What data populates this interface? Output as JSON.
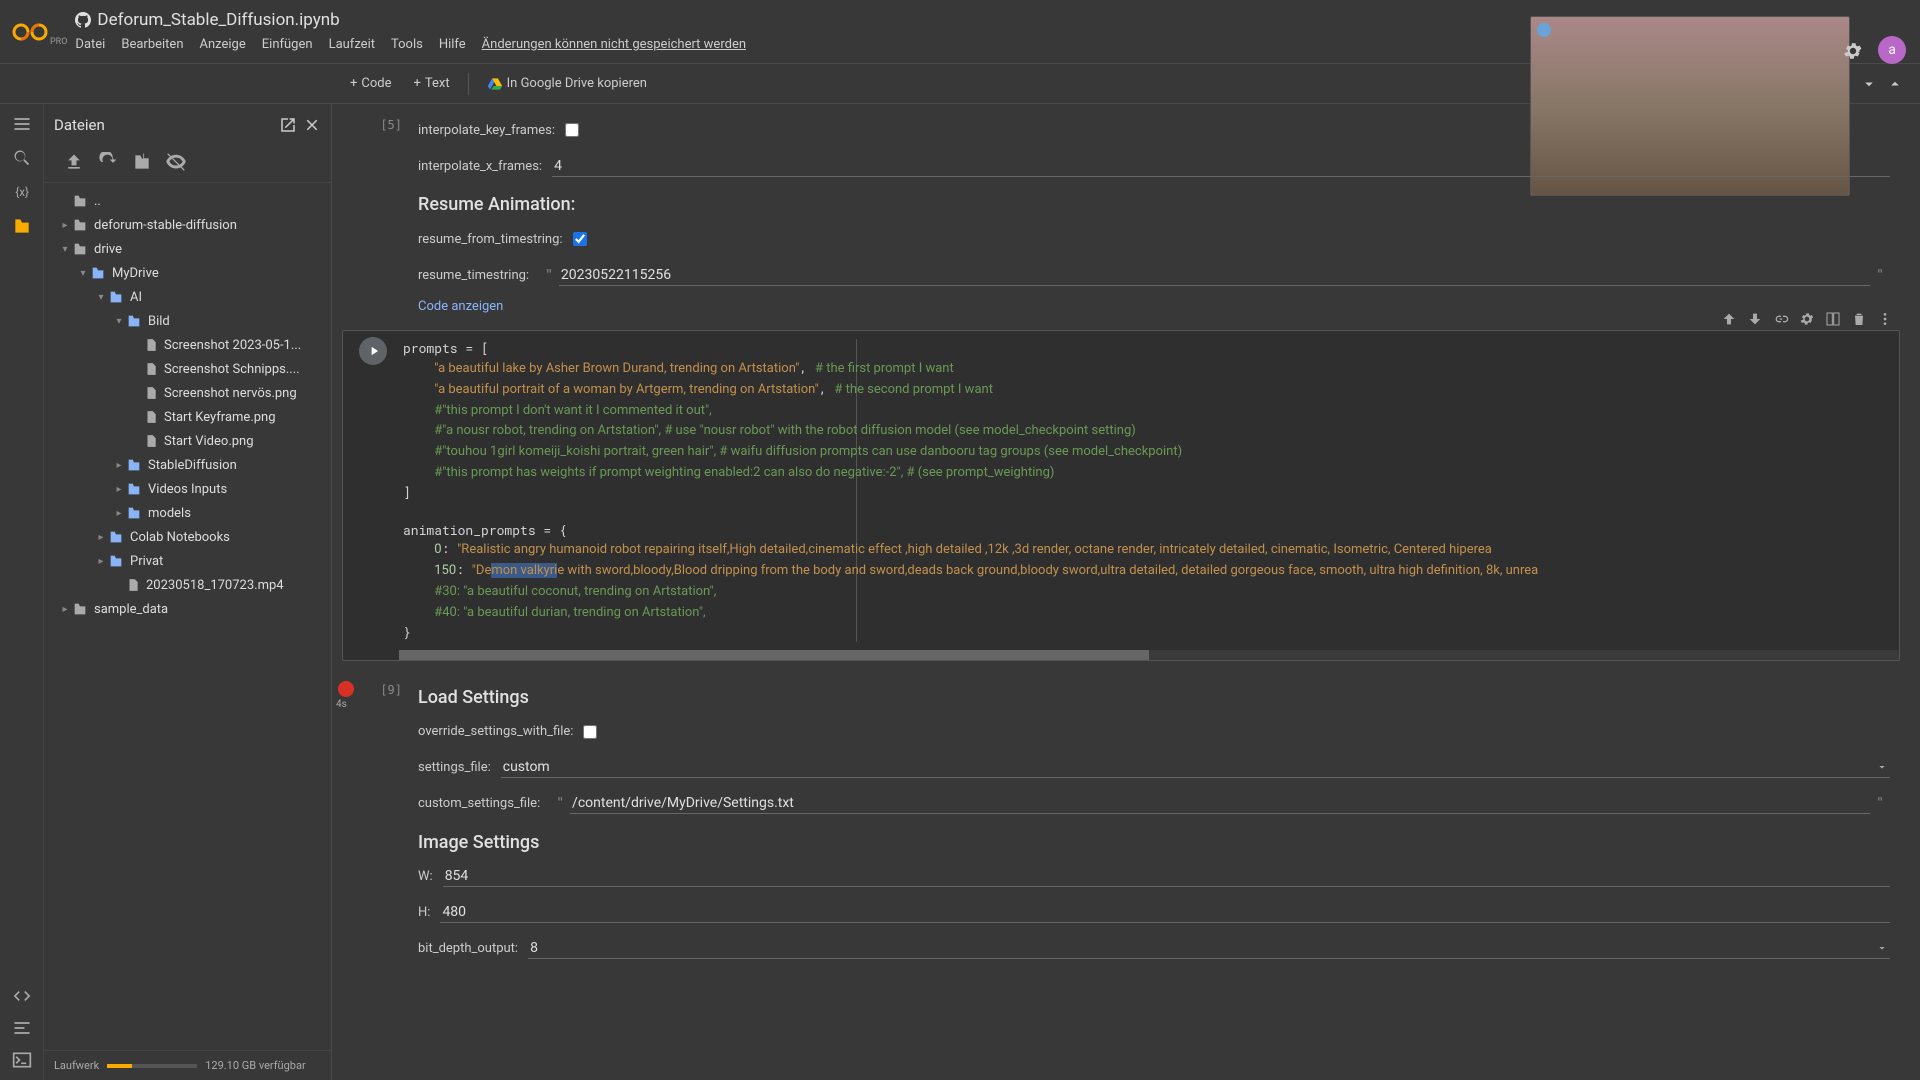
{
  "header": {
    "pro_label": "PRO",
    "notebook_title": "Deforum_Stable_Diffusion.ipynb",
    "menus": [
      "Datei",
      "Bearbeiten",
      "Anzeige",
      "Einfügen",
      "Laufzeit",
      "Tools",
      "Hilfe"
    ],
    "save_warning": "Änderungen können nicht gespeichert werden",
    "avatar_letter": "a"
  },
  "toolbar": {
    "code_label": "Code",
    "text_label": "Text",
    "drive_label": "In Google Drive kopieren"
  },
  "sidebar": {
    "title": "Dateien",
    "disk_label": "Laufwerk",
    "disk_free": "129.10 GB verfügbar",
    "tree": {
      "up_label": "..",
      "deforum": "deforum-stable-diffusion",
      "drive": "drive",
      "mydrive": "MyDrive",
      "ai": "AI",
      "bild": "Bild",
      "files_bild": [
        "Screenshot 2023-05-1...",
        "Screenshot Schnipps....",
        "Screenshot nervös.png",
        "Start Keyframe.png",
        "Start Video.png"
      ],
      "stablediffusion": "StableDiffusion",
      "videos_inputs": "Videos Inputs",
      "models": "models",
      "colab_notebooks": "Colab Notebooks",
      "privat": "Privat",
      "mp4_file": "20230518_170723.mp4",
      "sample_data": "sample_data"
    }
  },
  "cell1": {
    "exec_count": "[5]",
    "interpolate_key_frames_label": "interpolate_key_frames:",
    "interpolate_x_frames_label": "interpolate_x_frames:",
    "interpolate_x_frames_value": "4",
    "resume_title": "Resume Animation:",
    "resume_from_timestring_label": "resume_from_timestring:",
    "resume_from_timestring_checked": true,
    "resume_timestring_label": "resume_timestring:",
    "resume_timestring_value": "20230522115256",
    "show_code": "Code anzeigen"
  },
  "code_cell": {
    "lines": [
      {
        "plain": "prompts = ["
      },
      {
        "indent": "    ",
        "str": "\"a beautiful lake by Asher Brown Durand, trending on Artstation\"",
        "tail": ", ",
        "cmt": "# the first prompt I want"
      },
      {
        "indent": "    ",
        "str": "\"a beautiful portrait of a woman by Artgerm, trending on Artstation\"",
        "tail": ", ",
        "cmt": "# the second prompt I want"
      },
      {
        "indent": "    ",
        "cmt": "#\"this prompt I don't want it I commented it out\","
      },
      {
        "indent": "    ",
        "cmt": "#\"a nousr robot, trending on Artstation\", # use \"nousr robot\" with the robot diffusion model (see model_checkpoint setting)"
      },
      {
        "indent": "    ",
        "cmt": "#\"touhou 1girl komeiji_koishi portrait, green hair\", # waifu diffusion prompts can use danbooru tag groups (see model_checkpoint)"
      },
      {
        "indent": "    ",
        "cmt": "#\"this prompt has weights if prompt weighting enabled:2 can also do negative:-2\", # (see prompt_weighting)"
      },
      {
        "plain": "]"
      },
      {
        "plain": ""
      },
      {
        "plain": "animation_prompts = {"
      },
      {
        "indent": "    ",
        "key": "0",
        "str": "\"Realistic angry humanoid robot repairing itself,High detailed,cinematic effect ,high detailed ,12k ,3d render, octane render, intricately detailed, cinematic, Isometric, Centered hiperea"
      },
      {
        "indent": "    ",
        "key": "150",
        "pre": "\"De",
        "sel": "mon valkyri",
        "post": "e with sword,bloody,Blood dripping from the body and sword,deads back ground,bloody sword,ultra detailed, detailed gorgeous face, smooth, ultra high definition, 8k, unrea"
      },
      {
        "indent": "    ",
        "cmt": "#30: \"a beautiful coconut, trending on Artstation\","
      },
      {
        "indent": "    ",
        "cmt": "#40: \"a beautiful durian, trending on Artstation\","
      },
      {
        "plain": "}"
      }
    ]
  },
  "cell3": {
    "exec_count": "[9]",
    "exec_time": "4s",
    "load_settings_title": "Load Settings",
    "override_label": "override_settings_with_file:",
    "settings_file_label": "settings_file:",
    "settings_file_value": "custom",
    "custom_file_label": "custom_settings_file:",
    "custom_file_value": "/content/drive/MyDrive/Settings.txt",
    "image_settings_title": "Image Settings",
    "w_label": "W:",
    "w_value": "854",
    "h_label": "H:",
    "h_value": "480",
    "bit_depth_label": "bit_depth_output:",
    "bit_depth_value": "8"
  }
}
